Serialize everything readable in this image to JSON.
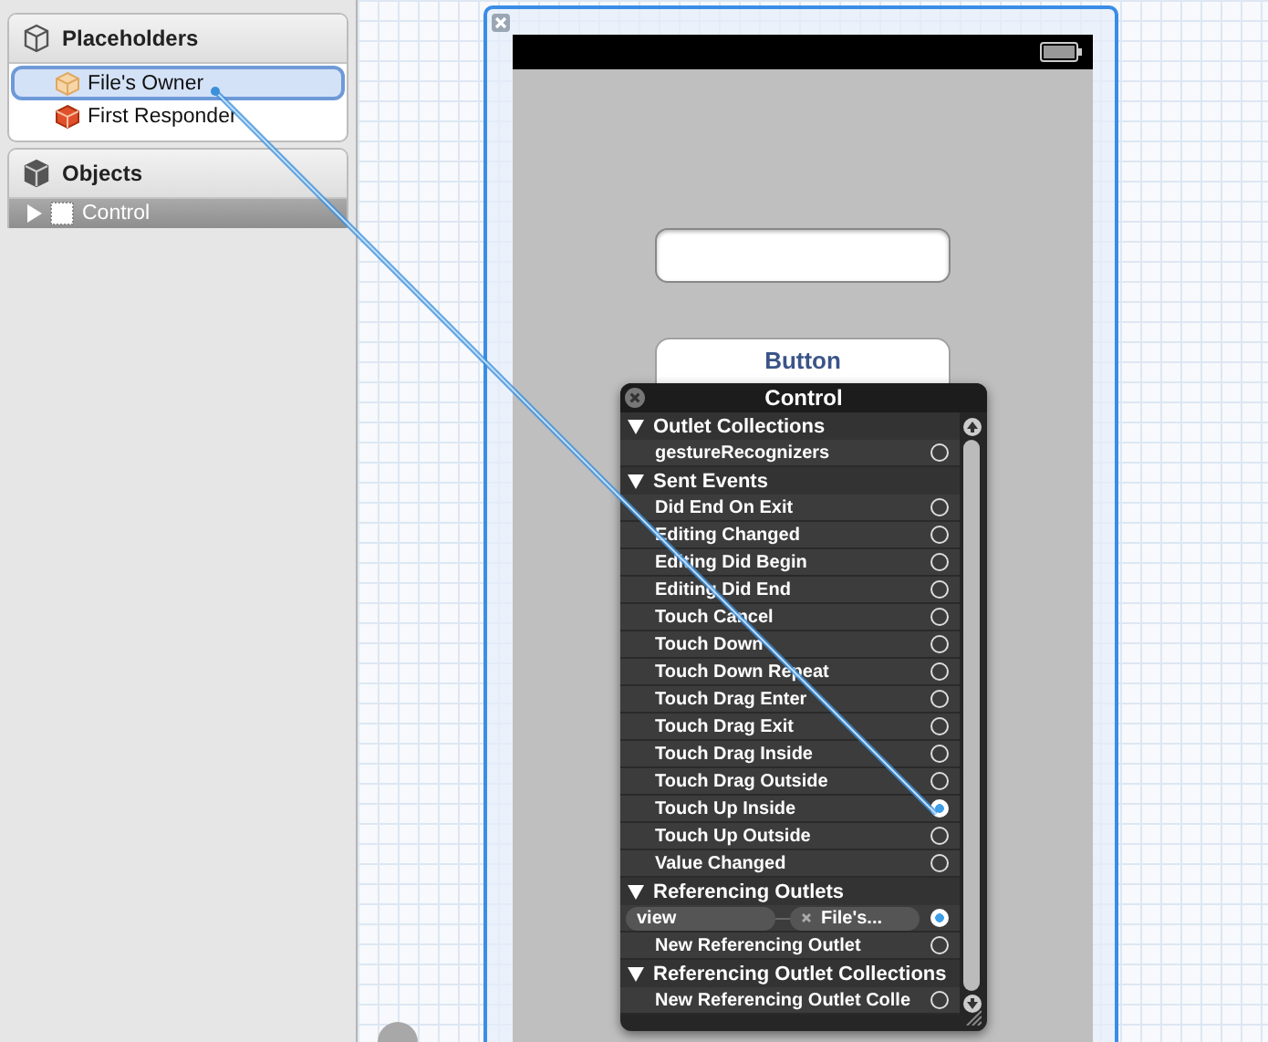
{
  "sidebar": {
    "sections": [
      {
        "title": "Placeholders",
        "kind": "placeholders",
        "items": [
          {
            "label": "File's Owner",
            "kind": "owner",
            "selected": true
          },
          {
            "label": "First Responder",
            "kind": "responder",
            "selected": false
          }
        ]
      },
      {
        "title": "Objects",
        "kind": "objects",
        "items": [
          {
            "label": "Control",
            "kind": "view",
            "selected": true,
            "expanded": false
          }
        ]
      }
    ]
  },
  "canvas": {
    "button": {
      "label": "Button"
    }
  },
  "popup": {
    "title": "Control",
    "sections": [
      {
        "title": "Outlet Collections",
        "expanded": true,
        "rows": [
          {
            "label": "gestureRecognizers",
            "kind": "plain",
            "connected": false
          }
        ]
      },
      {
        "title": "Sent Events",
        "expanded": true,
        "rows": [
          {
            "label": "Did End On Exit",
            "kind": "plain",
            "connected": false
          },
          {
            "label": "Editing Changed",
            "kind": "plain",
            "connected": false
          },
          {
            "label": "Editing Did Begin",
            "kind": "plain",
            "connected": false
          },
          {
            "label": "Editing Did End",
            "kind": "plain",
            "connected": false
          },
          {
            "label": "Touch Cancel",
            "kind": "plain",
            "connected": false
          },
          {
            "label": "Touch Down",
            "kind": "plain",
            "connected": false
          },
          {
            "label": "Touch Down Repeat",
            "kind": "plain",
            "connected": false
          },
          {
            "label": "Touch Drag Enter",
            "kind": "plain",
            "connected": false
          },
          {
            "label": "Touch Drag Exit",
            "kind": "plain",
            "connected": false
          },
          {
            "label": "Touch Drag Inside",
            "kind": "plain",
            "connected": false
          },
          {
            "label": "Touch Drag Outside",
            "kind": "plain",
            "connected": false
          },
          {
            "label": "Touch Up Inside",
            "kind": "plain",
            "connected": true
          },
          {
            "label": "Touch Up Outside",
            "kind": "plain",
            "connected": false
          },
          {
            "label": "Value Changed",
            "kind": "plain",
            "connected": false
          }
        ]
      },
      {
        "title": "Referencing Outlets",
        "expanded": true,
        "rows": [
          {
            "label": "view",
            "kind": "outlet",
            "target": "File's...",
            "connected": true
          },
          {
            "label": "New Referencing Outlet",
            "kind": "plain",
            "connected": false
          }
        ]
      },
      {
        "title": "Referencing Outlet Collections",
        "expanded": true,
        "rows": [
          {
            "label": "New Referencing Outlet Colle",
            "kind": "plain",
            "connected": false
          }
        ]
      }
    ]
  }
}
